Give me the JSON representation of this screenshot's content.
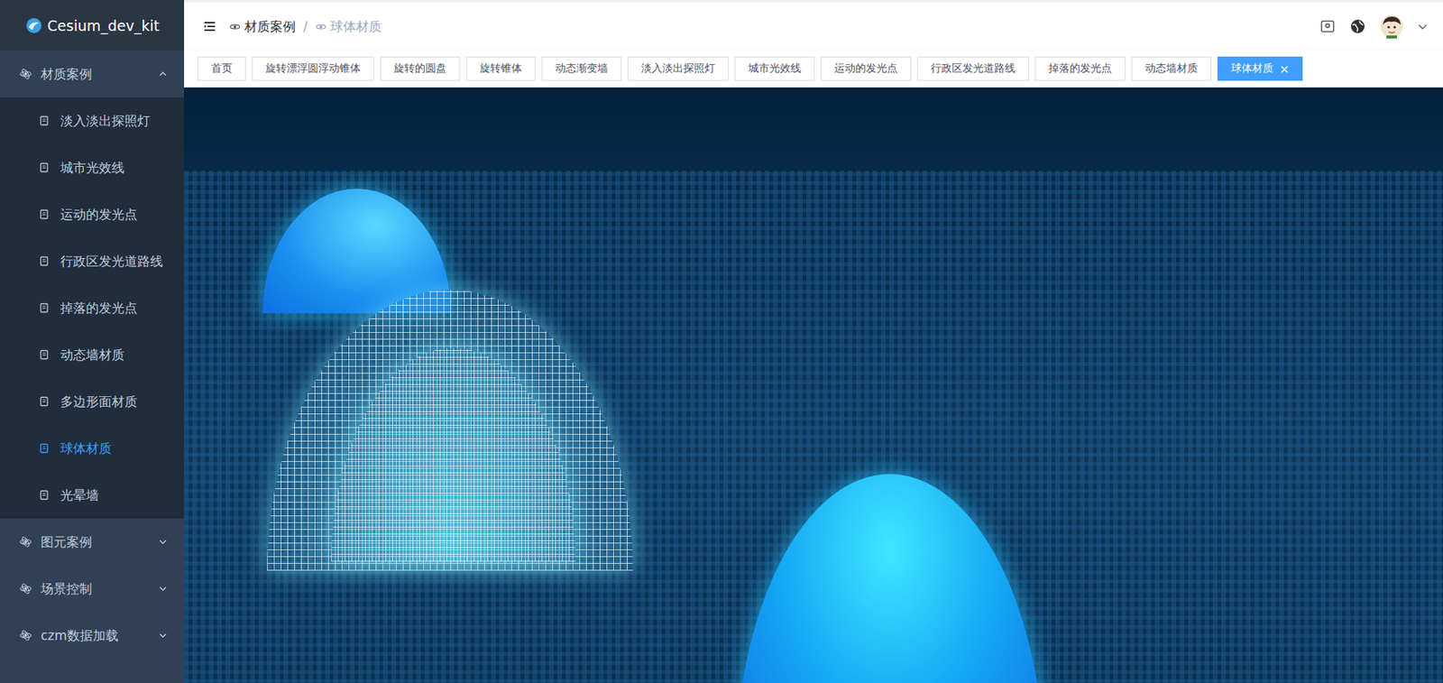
{
  "logo": {
    "title": "Cesium_dev_kit"
  },
  "sidebar": {
    "groups": [
      {
        "label": "材质案例",
        "expanded": true,
        "items": [
          {
            "label": "淡入淡出探照灯",
            "selected": false
          },
          {
            "label": "城市光效线",
            "selected": false
          },
          {
            "label": "运动的发光点",
            "selected": false
          },
          {
            "label": "行政区发光道路线",
            "selected": false
          },
          {
            "label": "掉落的发光点",
            "selected": false
          },
          {
            "label": "动态墙材质",
            "selected": false
          },
          {
            "label": "多边形面材质",
            "selected": false
          },
          {
            "label": "球体材质",
            "selected": true
          },
          {
            "label": "光晕墙",
            "selected": false
          }
        ]
      },
      {
        "label": "图元案例",
        "expanded": false,
        "items": []
      },
      {
        "label": "场景控制",
        "expanded": false,
        "items": []
      },
      {
        "label": "czm数据加载",
        "expanded": false,
        "items": []
      }
    ]
  },
  "breadcrumb": {
    "separator": "/",
    "items": [
      {
        "label": "材质案例",
        "current": false
      },
      {
        "label": "球体材质",
        "current": true
      }
    ]
  },
  "tabs": {
    "close_mark": "×",
    "items": [
      {
        "label": "首页",
        "selected": false
      },
      {
        "label": "旋转漂浮圆浮动锥体",
        "selected": false
      },
      {
        "label": "旋转的圆盘",
        "selected": false
      },
      {
        "label": "旋转锥体",
        "selected": false
      },
      {
        "label": "动态渐变墙",
        "selected": false
      },
      {
        "label": "淡入淡出探照灯",
        "selected": false
      },
      {
        "label": "城市光效线",
        "selected": false
      },
      {
        "label": "运动的发光点",
        "selected": false
      },
      {
        "label": "行政区发光道路线",
        "selected": false
      },
      {
        "label": "掉落的发光点",
        "selected": false
      },
      {
        "label": "动态墙材质",
        "selected": false
      },
      {
        "label": "球体材质",
        "selected": true
      }
    ]
  }
}
